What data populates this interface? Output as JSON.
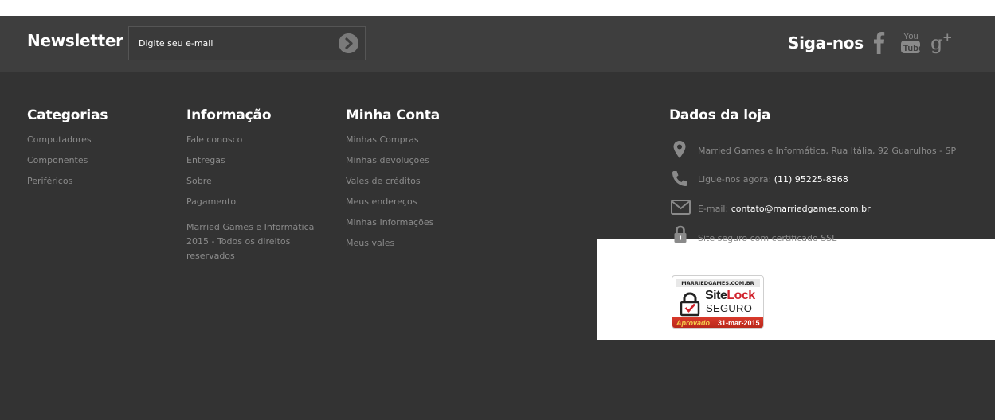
{
  "newsletter": {
    "title": "Newsletter",
    "placeholder": "Digite seu e-mail",
    "submit_icon": "arrow-circle-right-icon"
  },
  "social": {
    "title": "Siga-nos",
    "icons": [
      "facebook-icon",
      "youtube-icon",
      "google-plus-icon"
    ]
  },
  "columns": {
    "categorias": {
      "title": "Categorias",
      "links": [
        "Computadores",
        "Componentes",
        "Periféricos"
      ]
    },
    "informacao": {
      "title": "Informação",
      "links": [
        "Fale conosco",
        "Entregas",
        "Sobre",
        "Pagamento"
      ],
      "copyright": "Married Games e Informática 2015 - Todos os direitos reservados"
    },
    "minha_conta": {
      "title": "Minha Conta",
      "links": [
        "Minhas Compras",
        "Minhas devoluções",
        "Vales de créditos",
        "Meus endereços",
        "Minhas Informações",
        "Meus vales"
      ]
    }
  },
  "store": {
    "title": "Dados da loja",
    "address": "Married Games e Informática, Rua Itália, 92 Guarulhos - SP",
    "phone_label": "Ligue-nos agora: ",
    "phone": "(11) 95225-8368",
    "email_label": "E-mail: ",
    "email": "contato@marriedgames.com.br",
    "secure": "Site seguro com certificado SSL"
  },
  "sitelock": {
    "domain": "MARRIEDGAMES.COM.BR",
    "brand_site": "Site",
    "brand_lock": "Lock",
    "seguro": "SEGURO",
    "aprovado": "Aprovado",
    "date": "31-mar-2015"
  },
  "colors": {
    "newsbar_bg": "#3e3e3e",
    "footer_bg": "#333333",
    "link_gray": "#8a8a8a",
    "sitelock_red": "#d0202a"
  }
}
